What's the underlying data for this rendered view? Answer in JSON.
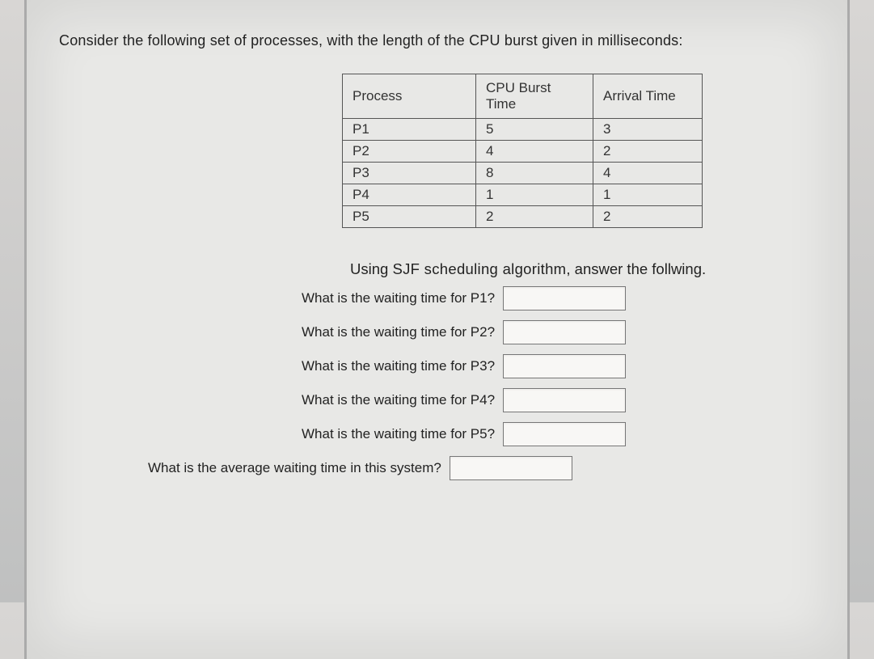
{
  "intro": "Consider the following set of processes, with the length of the CPU burst given in milliseconds:",
  "table": {
    "headers": {
      "process": "Process",
      "burst": "CPU Burst Time",
      "arrival": "Arrival Time"
    },
    "rows": [
      {
        "process": "P1",
        "burst": "5",
        "arrival": "3"
      },
      {
        "process": "P2",
        "burst": "4",
        "arrival": "2"
      },
      {
        "process": "P3",
        "burst": "8",
        "arrival": "4"
      },
      {
        "process": "P4",
        "burst": "1",
        "arrival": "1"
      },
      {
        "process": "P5",
        "burst": "2",
        "arrival": "2"
      }
    ]
  },
  "subheading": {
    "prefix": "Using ",
    "algo": "SJF scheduling algorithm",
    "suffix": ", answer the follwing."
  },
  "questions": {
    "q1": "What is the waiting time for P1?",
    "q2": "What is the waiting time for P2?",
    "q3": "What is the waiting time for P3?",
    "q4": "What is the waiting time for P4?",
    "q5": "What is the waiting time for P5?",
    "avg": "What is the average waiting time in this system?"
  }
}
